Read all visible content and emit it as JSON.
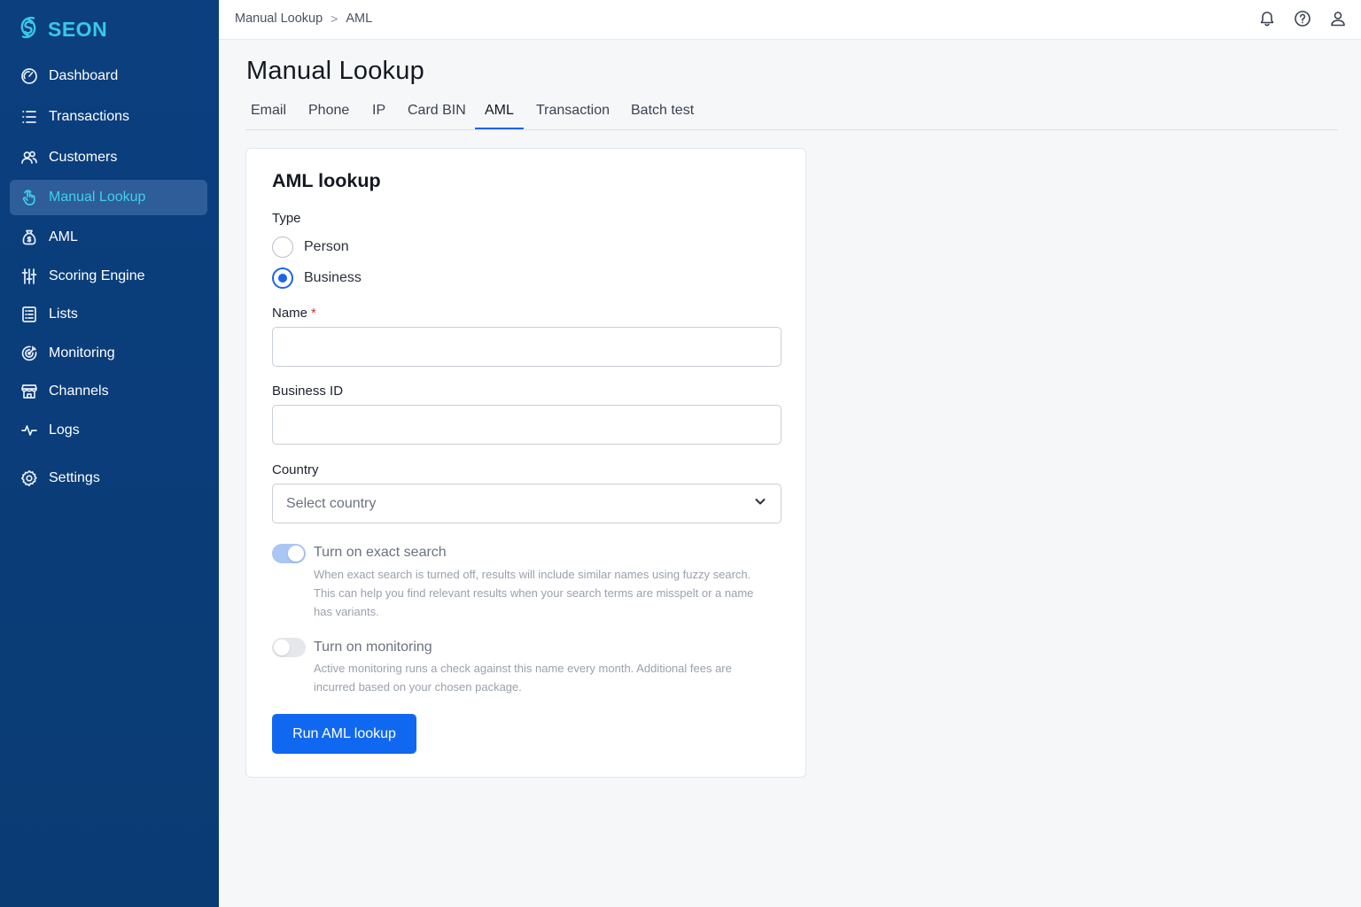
{
  "brand": {
    "name": "SEON",
    "accent": "#39c8e6"
  },
  "sidebar": {
    "items": [
      {
        "label": "Dashboard",
        "icon": "gauge-icon"
      },
      {
        "label": "Transactions",
        "icon": "list-icon"
      },
      {
        "label": "Customers",
        "icon": "users-icon"
      },
      {
        "label": "Manual Lookup",
        "icon": "pointer-hand-icon",
        "active": true
      },
      {
        "label": "AML",
        "icon": "money-bag-icon"
      },
      {
        "label": "Scoring Engine",
        "icon": "sliders-icon"
      },
      {
        "label": "Lists",
        "icon": "list-box-icon"
      },
      {
        "label": "Monitoring",
        "icon": "target-icon"
      },
      {
        "label": "Channels",
        "icon": "storefront-icon"
      },
      {
        "label": "Logs",
        "icon": "activity-icon"
      },
      {
        "label": "Settings",
        "icon": "gear-icon"
      }
    ]
  },
  "breadcrumb": {
    "parent": "Manual Lookup",
    "separator": ">",
    "current": "AML"
  },
  "topbar": {
    "icons": [
      "bell-icon",
      "help-icon",
      "user-icon"
    ]
  },
  "page": {
    "title": "Manual Lookup"
  },
  "tabs": [
    {
      "label": "Email"
    },
    {
      "label": "Phone"
    },
    {
      "label": "IP"
    },
    {
      "label": "Card BIN"
    },
    {
      "label": "AML",
      "active": true
    },
    {
      "label": "Transaction"
    },
    {
      "label": "Batch test"
    }
  ],
  "form": {
    "title": "AML lookup",
    "type_label": "Type",
    "type_options": [
      {
        "label": "Person",
        "selected": false
      },
      {
        "label": "Business",
        "selected": true
      }
    ],
    "name_label": "Name",
    "name_required": "*",
    "name_value": "",
    "business_id_label": "Business ID",
    "business_id_value": "",
    "country_label": "Country",
    "country_placeholder": "Select country",
    "exact_search": {
      "title": "Turn on exact search",
      "enabled": true,
      "description": "When exact search is turned off, results will include similar names using fuzzy search. This can help you find relevant results when your search terms are misspelt or a name has variants."
    },
    "monitoring": {
      "title": "Turn on monitoring",
      "enabled": false,
      "description": "Active monitoring runs a check against this name every month. Additional fees are incurred based on your chosen package."
    },
    "submit_label": "Run AML lookup"
  },
  "colors": {
    "primary": "#1168f0",
    "sidebar_bg": "#0b3f7e",
    "active_text": "#3fd0ec"
  }
}
